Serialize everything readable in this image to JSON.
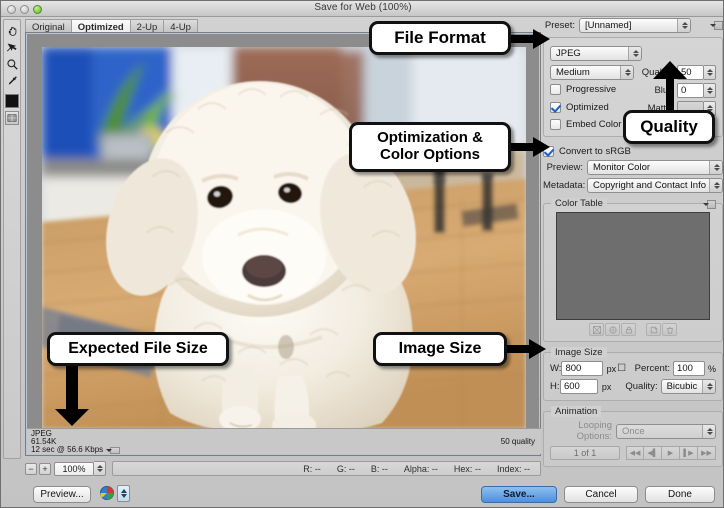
{
  "window": {
    "title": "Save for Web (100%)"
  },
  "toolbar": {
    "tools": [
      {
        "name": "hand-tool",
        "label": "Hand"
      },
      {
        "name": "slice-select-tool",
        "label": "Slice Select"
      },
      {
        "name": "zoom-tool",
        "label": "Zoom"
      },
      {
        "name": "eyedropper-tool",
        "label": "Eyedropper"
      },
      {
        "name": "foreground-color-swatch",
        "label": "Eyedropper Color"
      },
      {
        "name": "toggle-slices-visibility",
        "label": "Toggle Slices Visibility"
      }
    ]
  },
  "tabs": [
    {
      "label": "Original",
      "active": false
    },
    {
      "label": "Optimized",
      "active": true
    },
    {
      "label": "2-Up",
      "active": false
    },
    {
      "label": "4-Up",
      "active": false
    }
  ],
  "image_info": {
    "format": "JPEG",
    "file_size": "61.54K",
    "download_time": "12 sec @ 56.6 Kbps",
    "quality_note": "50 quality"
  },
  "settings": {
    "preset_label": "Preset:",
    "preset_value": "[Unnamed]",
    "file_format": "JPEG",
    "compression_quality": "Medium",
    "quality_label": "Quality:",
    "quality_value": "50",
    "blur_label": "Blur:",
    "blur_value": "0",
    "matte_label": "Matte:",
    "matte_value": "",
    "checkboxes": [
      {
        "label": "Progressive",
        "checked": false
      },
      {
        "label": "Optimized",
        "checked": true
      },
      {
        "label": "Embed Color Profile",
        "checked": false
      }
    ],
    "convert_srgb_label": "Convert to sRGB",
    "convert_srgb_checked": true,
    "preview_label": "Preview:",
    "preview_value": "Monitor Color",
    "metadata_label": "Metadata:",
    "metadata_value": "Copyright and Contact Info"
  },
  "color_table": {
    "title": "Color Table",
    "icons": [
      "map-transparency-icon",
      "web-shift-icon",
      "lock-color-icon",
      "new-color-icon",
      "delete-color-icon"
    ]
  },
  "image_size": {
    "title": "Image Size",
    "width_label": "W:",
    "width_value": "800",
    "width_unit": "px",
    "height_label": "H:",
    "height_value": "600",
    "height_unit": "px",
    "percent_label": "Percent:",
    "percent_value": "100",
    "percent_unit": "%",
    "quality_label": "Quality:",
    "quality_value": "Bicubic"
  },
  "animation": {
    "title": "Animation",
    "looping_label": "Looping Options:",
    "looping_value": "Once",
    "frame_counter": "1 of 1",
    "buttons": [
      "first-frame-icon",
      "previous-frame-icon",
      "play-icon",
      "next-frame-icon",
      "last-frame-icon"
    ]
  },
  "zoombar": {
    "zoom_value": "100%",
    "readouts": [
      {
        "label": "R:",
        "value": "--"
      },
      {
        "label": "G:",
        "value": "--"
      },
      {
        "label": "B:",
        "value": "--"
      },
      {
        "label": "Alpha:",
        "value": "--"
      },
      {
        "label": "Hex:",
        "value": "--"
      },
      {
        "label": "Index:",
        "value": "--"
      }
    ]
  },
  "footer": {
    "preview_button": "Preview...",
    "save_button": "Save...",
    "cancel_button": "Cancel",
    "done_button": "Done"
  },
  "callouts": [
    {
      "id": "file-format",
      "text": "File Format"
    },
    {
      "id": "quality",
      "text": "Quality"
    },
    {
      "id": "optimization-color-options",
      "text": "Optimization &\nColor Options"
    },
    {
      "id": "expected-file-size",
      "text": "Expected File Size"
    },
    {
      "id": "image-size",
      "text": "Image Size"
    }
  ],
  "colors": {
    "accent": "#4d8fe0",
    "panel_bg": "#d0d0d0",
    "canvas_bg": "#8c8c8c",
    "color_table_swatch": "#6e6e6e"
  }
}
